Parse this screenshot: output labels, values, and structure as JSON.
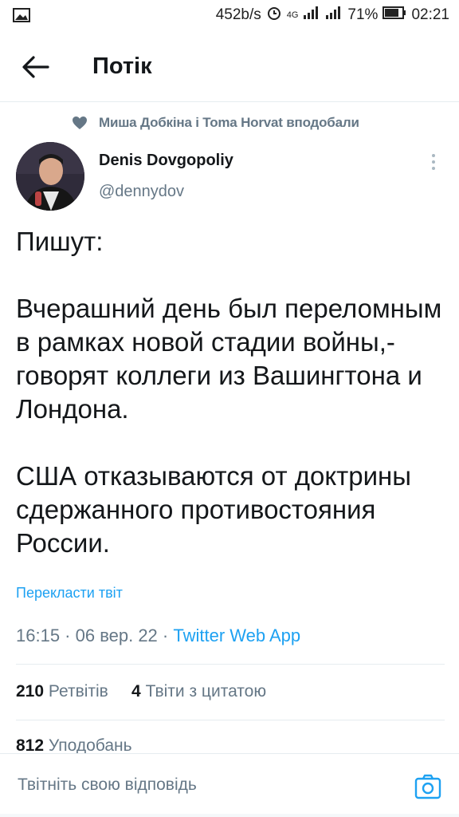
{
  "status_bar": {
    "net_speed": "452b/s",
    "network_type": "4G",
    "battery": "71%",
    "time": "02:21"
  },
  "header": {
    "title": "Потік"
  },
  "social_context": {
    "text": "Миша Добкіна і Toma Horvat вподобали"
  },
  "tweet": {
    "author_name": "Denis Dovgopoliy",
    "author_handle": "@dennydov",
    "paragraphs": [
      "Пишут:",
      "Вчерашний день был переломным в рамках новой стадии войны,- говорят коллеги из Вашингтона и Лондона.",
      "США отказываются от доктрины сдержанного противостояния России."
    ],
    "translate_label": "Перекласти твіт",
    "timestamp": "16:15 · 06 вер. 22 · ",
    "source": "Twitter Web App"
  },
  "stats": {
    "retweets_count": "210",
    "retweets_label": "Ретвітів",
    "quotes_count": "4",
    "quotes_label": "Твіти з цитатою",
    "likes_count": "812",
    "likes_label": "Уподобань"
  },
  "reply": {
    "placeholder": "Твітніть свою відповідь"
  },
  "colors": {
    "accent": "#1da1f2",
    "text_primary": "#14171a",
    "text_secondary": "#657786",
    "divider": "#e6ecf0"
  },
  "icons": {
    "back": "arrow-left-icon",
    "heart": "heart-icon",
    "more": "more-vertical-icon",
    "camera": "camera-icon",
    "image": "image-icon",
    "alarm": "alarm-icon",
    "signal": "signal-icon",
    "battery": "battery-icon"
  }
}
